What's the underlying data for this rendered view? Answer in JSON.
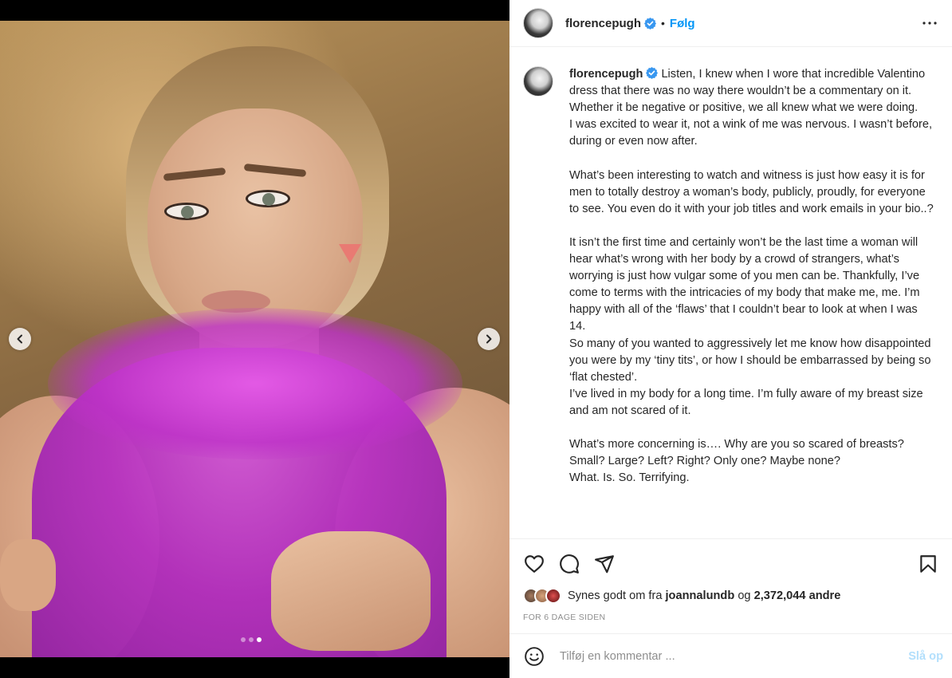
{
  "header": {
    "username": "florencepugh",
    "separator": "•",
    "follow_label": "Følg"
  },
  "caption": {
    "username": "florencepugh",
    "text": "Listen, I knew when I wore that incredible Valentino dress that there was no way there wouldn’t be a commentary on it. Whether it be negative or positive, we all knew what we were doing.\nI was excited to wear it, not a wink of me was nervous. I wasn’t before, during or even now after.\n\nWhat’s been interesting to watch and witness is just how easy it is for men to totally destroy a woman’s body, publicly, proudly, for everyone to see. You even do it with your job titles and work emails in your bio..?\n\nIt isn’t the first time and certainly won’t be the last time a woman will hear what’s wrong with her body by a crowd of strangers, what’s worrying is just how vulgar some of you men can be. Thankfully, I’ve come to terms with the intricacies of my body that make me, me. I’m happy with all of the ‘flaws’ that I couldn’t bear to look at when I was 14.\nSo many of you wanted to aggressively let me know how disappointed you were by my ‘tiny tits’, or how I should be embarrassed by being so ‘flat chested’.\nI’ve lived in my body for a long time. I’m fully aware of my breast size and am not scared of it.\n\nWhat’s more concerning is…. Why are you so scared of breasts? Small? Large? Left? Right? Only one? Maybe none?\nWhat. Is. So. Terrifying."
  },
  "likes": {
    "prefix": "Synes godt om fra",
    "first_user": "joannalundb",
    "connector": "og",
    "count": "2,372,044",
    "suffix": "andre"
  },
  "timestamp": "FOR 6 DAGE SIDEN",
  "comment": {
    "placeholder": "Tilføj en kommentar ...",
    "post_label": "Slå op"
  },
  "carousel": {
    "slide_count": 3,
    "active_slide": 3
  },
  "colors": {
    "accent": "#0095f6",
    "post_disabled": "#b2dffc",
    "verified": "#3897f0",
    "muted": "#8e8e8e"
  }
}
